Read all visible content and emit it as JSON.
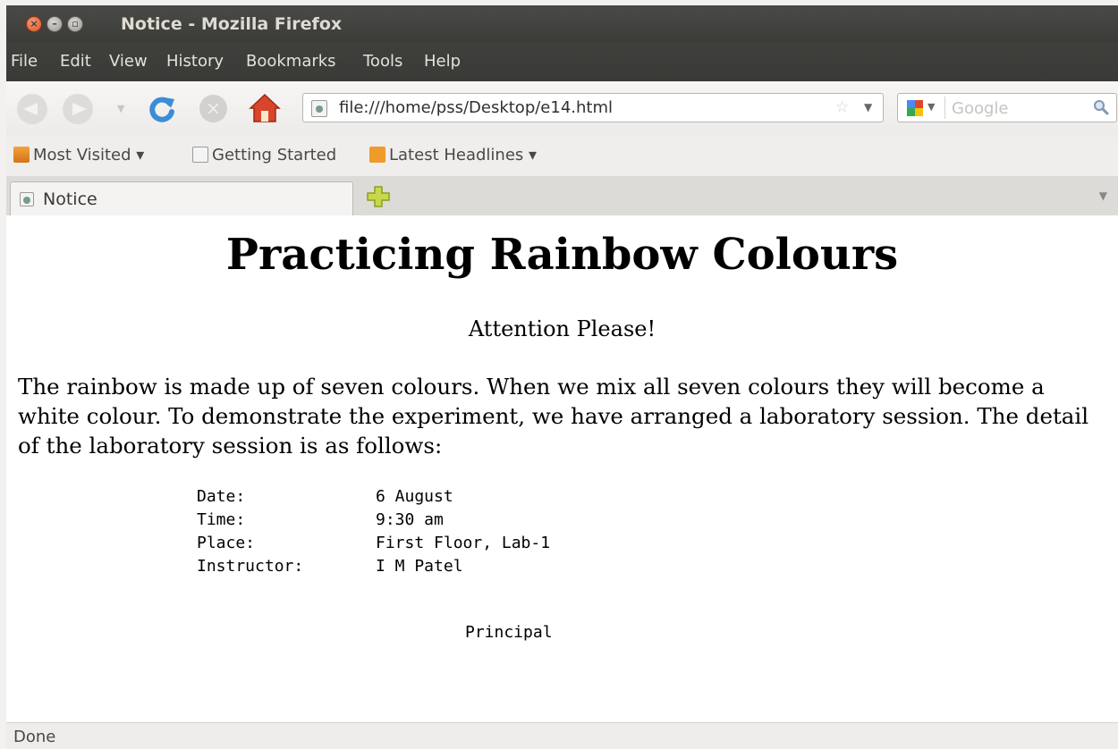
{
  "window": {
    "title": "Notice - Mozilla Firefox"
  },
  "menubar": {
    "items": [
      "File",
      "Edit",
      "View",
      "History",
      "Bookmarks",
      "Tools",
      "Help"
    ]
  },
  "navbar": {
    "url": "file:///home/pss/Desktop/e14.html",
    "search_placeholder": "Google"
  },
  "bookmarks": {
    "items": [
      {
        "label": "Most Visited ▾",
        "icon": "most-visited-icon"
      },
      {
        "label": "Getting Started",
        "icon": "page-icon"
      },
      {
        "label": "Latest Headlines ▾",
        "icon": "rss-icon"
      }
    ]
  },
  "tabs": [
    {
      "label": "Notice",
      "active": true
    }
  ],
  "page": {
    "heading": "Practicing Rainbow Colours",
    "attention": "Attention Please!",
    "paragraph": "The rainbow is made up of seven colours. When we mix all seven colours they will become a white colour. To demonstrate the experiment, we have arranged a laboratory session. The detail of the laboratory session is as follows:",
    "details": [
      {
        "label": "Date:",
        "value": "6 August"
      },
      {
        "label": "Time:",
        "value": "9:30 am"
      },
      {
        "label": "Place:",
        "value": "First Floor, Lab-1"
      },
      {
        "label": "Instructor:",
        "value": "I M Patel"
      }
    ],
    "signature": "Principal"
  },
  "status": {
    "text": "Done"
  },
  "colors": {
    "titlebar": "#3b3b38",
    "close_button": "#d9531e",
    "reload_blue": "#3b8ed6",
    "home_red": "#d9452a"
  }
}
